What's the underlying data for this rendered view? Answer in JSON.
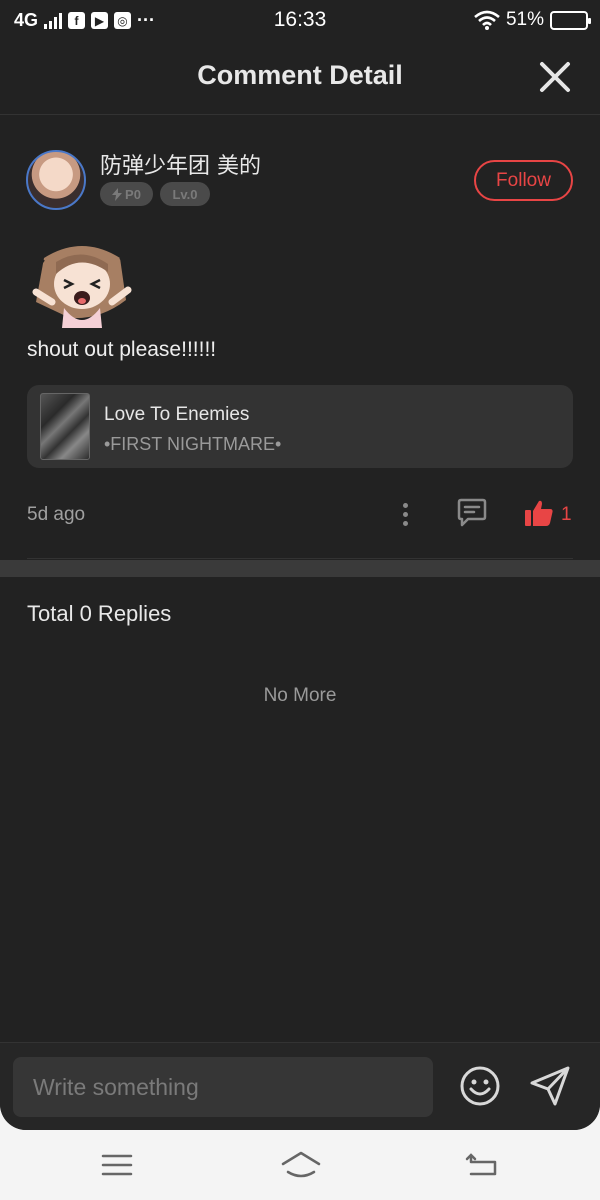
{
  "status_bar": {
    "network": "4G",
    "time": "16:33",
    "battery": "51%",
    "battery_level": 0.51,
    "more": "···",
    "icons": [
      "signal-icon",
      "facebook-icon",
      "youtube-icon",
      "instagram-icon",
      "wifi-icon",
      "battery-icon"
    ]
  },
  "header": {
    "title": "Comment Detail",
    "close_icon": "close-icon"
  },
  "comment": {
    "author": "防弹少年团 美的",
    "badges": [
      {
        "label": "P0",
        "icon": "bolt-icon"
      },
      {
        "label": "Lv.0"
      }
    ],
    "follow_label": "Follow",
    "text": "shout out please!!!!!!",
    "time_ago": "5d ago",
    "likes": "1",
    "liked": true,
    "book": {
      "title": "Love To Enemies",
      "subtitle": "•FIRST NIGHTMARE•"
    }
  },
  "replies": {
    "title": "Total 0 Replies",
    "empty_label": "No More"
  },
  "composer": {
    "placeholder": "Write something"
  },
  "nav": {
    "icons": [
      "menu-icon",
      "home-icon",
      "back-icon"
    ]
  },
  "colors": {
    "background": "#222222",
    "accent": "#e84545",
    "card": "#333333",
    "muted": "#9a9a9a"
  }
}
